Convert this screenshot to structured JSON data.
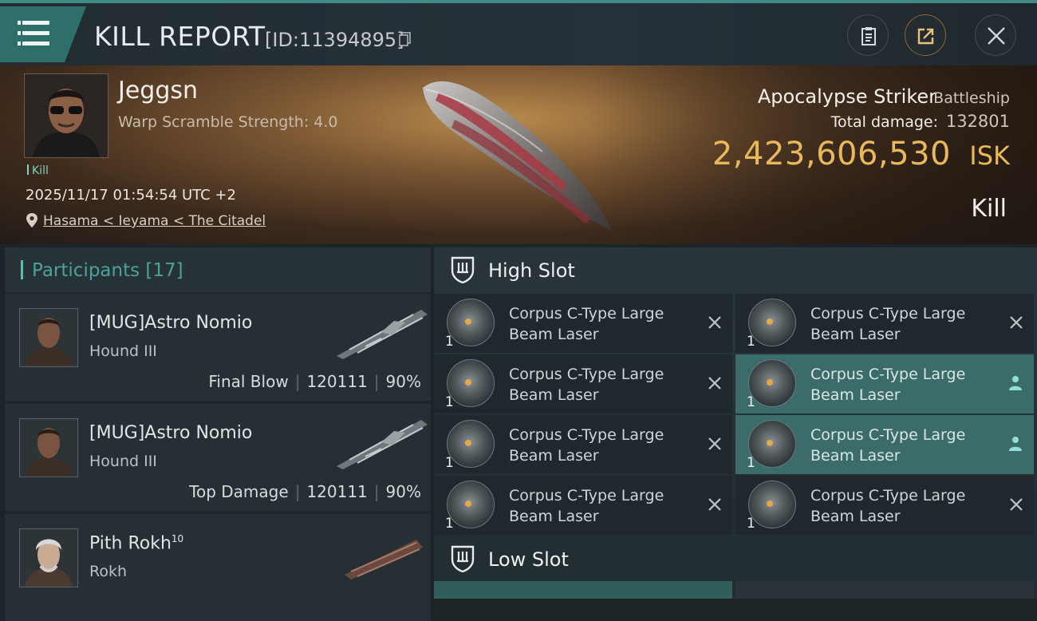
{
  "header": {
    "title": "KILL REPORT",
    "report_id": "[ID:11394895]",
    "icons": [
      "menu-icon",
      "copy-icon",
      "clipboard-icon",
      "share-icon",
      "close-icon"
    ]
  },
  "victim": {
    "name": "Jeggsn",
    "warp_scramble": "Warp Scramble Strength: 4.0",
    "tag": "Kill",
    "datetime": "2025/11/17 01:54:54 UTC +2",
    "location": "Hasama < Ieyama < The Citadel",
    "ship_name": "Apocalypse Striker",
    "ship_class": "Battleship",
    "total_damage_label": "Total damage:",
    "total_damage": "132801",
    "isk_value": "2,423,606,530",
    "isk_unit": "ISK",
    "result": "Kill"
  },
  "participants": {
    "label": "Participants [17]",
    "items": [
      {
        "name": "[MUG]Astro Nomio",
        "ship": "Hound III",
        "role": "Final Blow",
        "damage": "120111",
        "percent": "90%"
      },
      {
        "name": "[MUG]Astro Nomio",
        "ship": "Hound III",
        "role": "Top Damage",
        "damage": "120111",
        "percent": "90%"
      },
      {
        "name": "Pith Rokh",
        "level": "10",
        "ship": "Rokh"
      }
    ]
  },
  "slots": {
    "high_label": "High Slot",
    "low_label": "Low Slot",
    "modules": [
      {
        "line1": "Corpus C-Type Large",
        "line2": "Beam Laser",
        "qty": "1",
        "state": "destroyed"
      },
      {
        "line1": "Corpus C-Type Large",
        "line2": "Beam Laser",
        "qty": "1",
        "state": "destroyed"
      },
      {
        "line1": "Corpus C-Type Large",
        "line2": "Beam Laser",
        "qty": "1",
        "state": "destroyed"
      },
      {
        "line1": "Corpus C-Type Large",
        "line2": "Beam Laser",
        "qty": "1",
        "state": "dropped"
      },
      {
        "line1": "Corpus C-Type Large",
        "line2": "Beam Laser",
        "qty": "1",
        "state": "destroyed"
      },
      {
        "line1": "Corpus C-Type Large",
        "line2": "Beam Laser",
        "qty": "1",
        "state": "dropped"
      },
      {
        "line1": "Corpus C-Type Large",
        "line2": "Beam Laser",
        "qty": "1",
        "state": "destroyed"
      },
      {
        "line1": "Corpus C-Type Large",
        "line2": "Beam Laser",
        "qty": "1",
        "state": "destroyed"
      }
    ]
  },
  "colors": {
    "accent_teal": "#3f8c86",
    "isk_gold": "#e9b85a",
    "dropped_row": "#3c6c69"
  }
}
